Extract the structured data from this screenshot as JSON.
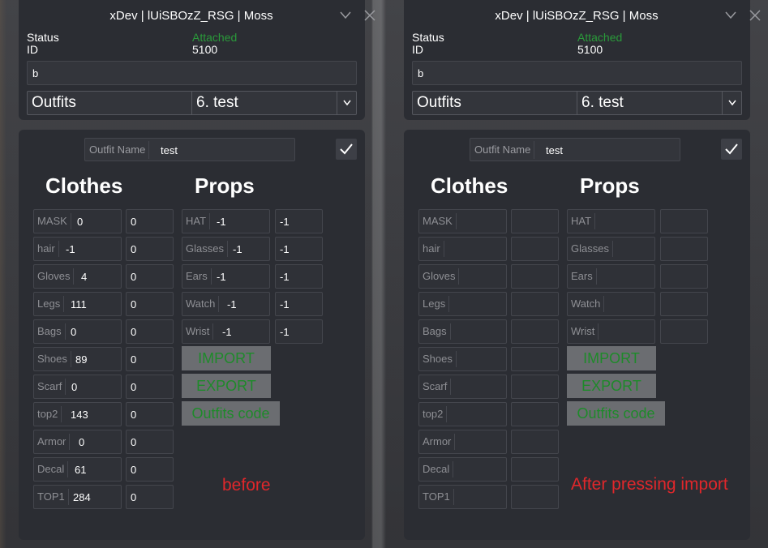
{
  "window_title": "xDev | lUiSBOzZ_RSG |  Moss",
  "status_label": "Status",
  "id_label": "ID",
  "status_value": "Attached",
  "id_value": "5100",
  "text_input_value": "b",
  "combo_label": "Outfits",
  "combo_selected": "6. test",
  "outfit_name_label": "Outfit Name",
  "outfit_name_value": "test",
  "clothes_heading": "Clothes",
  "props_heading": "Props",
  "import_label": "IMPORT",
  "export_label": "EXPORT",
  "code_label": "Outfits code",
  "colors": {
    "accent_green": "#2a9a3a",
    "note_red": "#e0272b"
  },
  "left": {
    "note": "before",
    "clothes": [
      {
        "label": "MASK",
        "value": "0",
        "texture": "0"
      },
      {
        "label": "hair",
        "value": "-1",
        "texture": "0"
      },
      {
        "label": "Gloves",
        "value": "4",
        "texture": "0"
      },
      {
        "label": "Legs",
        "value": "111",
        "texture": "0"
      },
      {
        "label": "Bags",
        "value": "0",
        "texture": "0"
      },
      {
        "label": "Shoes",
        "value": "89",
        "texture": "0"
      },
      {
        "label": "Scarf",
        "value": "0",
        "texture": "0"
      },
      {
        "label": "top2",
        "value": "143",
        "texture": "0"
      },
      {
        "label": "Armor",
        "value": "0",
        "texture": "0"
      },
      {
        "label": "Decal",
        "value": "61",
        "texture": "0"
      },
      {
        "label": "TOP1",
        "value": "284",
        "texture": "0"
      }
    ],
    "props": [
      {
        "label": "HAT",
        "value": "-1",
        "texture": "-1"
      },
      {
        "label": "Glasses",
        "value": "-1",
        "texture": "-1"
      },
      {
        "label": "Ears",
        "value": "-1",
        "texture": "-1"
      },
      {
        "label": "Watch",
        "value": "-1",
        "texture": "-1"
      },
      {
        "label": "Wrist",
        "value": "-1",
        "texture": "-1"
      }
    ]
  },
  "right": {
    "note": "After pressing import",
    "clothes": [
      {
        "label": "MASK",
        "value": "",
        "texture": ""
      },
      {
        "label": "hair",
        "value": "",
        "texture": ""
      },
      {
        "label": "Gloves",
        "value": "",
        "texture": ""
      },
      {
        "label": "Legs",
        "value": "",
        "texture": ""
      },
      {
        "label": "Bags",
        "value": "",
        "texture": ""
      },
      {
        "label": "Shoes",
        "value": "",
        "texture": ""
      },
      {
        "label": "Scarf",
        "value": "",
        "texture": ""
      },
      {
        "label": "top2",
        "value": "",
        "texture": ""
      },
      {
        "label": "Armor",
        "value": "",
        "texture": ""
      },
      {
        "label": "Decal",
        "value": "",
        "texture": ""
      },
      {
        "label": "TOP1",
        "value": "",
        "texture": ""
      }
    ],
    "props": [
      {
        "label": "HAT",
        "value": "",
        "texture": ""
      },
      {
        "label": "Glasses",
        "value": "",
        "texture": ""
      },
      {
        "label": "Ears",
        "value": "",
        "texture": ""
      },
      {
        "label": "Watch",
        "value": "",
        "texture": ""
      },
      {
        "label": "Wrist",
        "value": "",
        "texture": ""
      }
    ]
  }
}
